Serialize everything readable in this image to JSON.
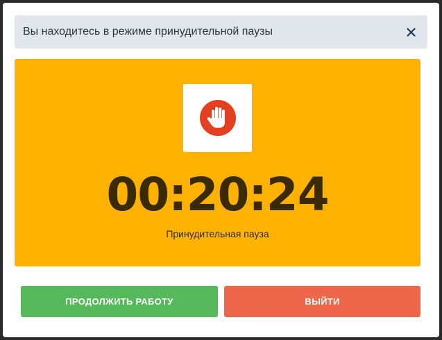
{
  "dialog": {
    "title": "Вы находитесь в режиме принудительной паузы",
    "close_icon": "close-icon"
  },
  "panel": {
    "icon": "stop-hand-icon",
    "timer": "00:20:24",
    "label": "Принудительная пауза"
  },
  "buttons": {
    "continue_label": "ПРОДОЛЖИТЬ РАБОТУ",
    "exit_label": "ВЫЙТИ"
  },
  "colors": {
    "header_bg": "#e1e7ec",
    "panel_bg": "#ffb300",
    "continue_bg": "#55b85a",
    "exit_bg": "#ee674b",
    "icon_red": "#e53f22"
  }
}
